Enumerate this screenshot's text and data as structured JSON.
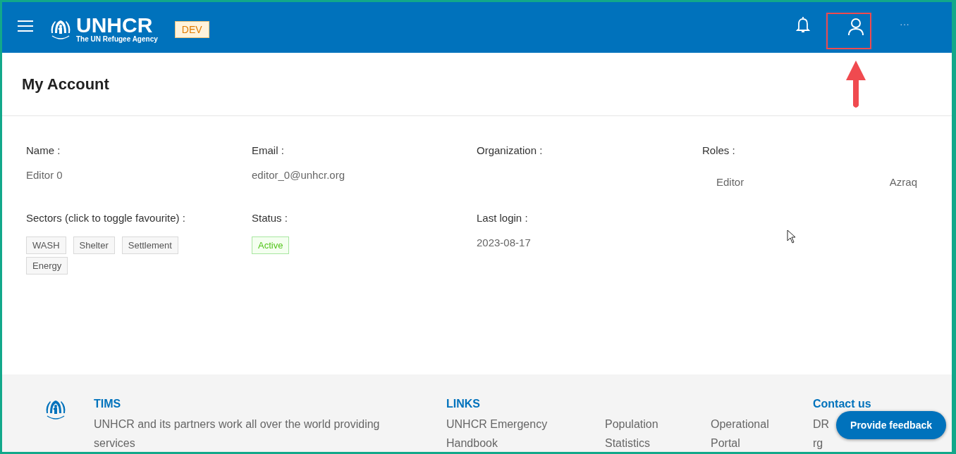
{
  "header": {
    "brand": "UNHCR",
    "tagline": "The UN Refugee Agency",
    "env_badge": "DEV",
    "more": "···"
  },
  "account_button": {
    "highlighted": true
  },
  "page_title": "My Account",
  "fields": [
    {
      "kind": "text",
      "label": "Name :",
      "value": "Editor 0"
    },
    {
      "kind": "text",
      "label": "Email :",
      "value": "editor_0@unhcr.org"
    },
    {
      "kind": "text",
      "label": "Organization :"
    },
    {
      "kind": "roles",
      "label": "Roles :",
      "roles": [
        {
          "role": "Editor",
          "location": "Azraq"
        }
      ]
    },
    {
      "kind": "tags",
      "label": "Sectors (click to toggle favourite) :",
      "tags": [
        "WASH",
        "Shelter",
        "Settlement",
        "Energy"
      ]
    },
    {
      "kind": "status",
      "label": "Status :",
      "value": "Active"
    },
    {
      "kind": "text",
      "label": "Last login :",
      "value": "2023-08-17"
    }
  ],
  "footer": {
    "about": {
      "title": "TIMS",
      "text": "UNHCR and its partners work all over the world providing services"
    },
    "links": {
      "title": "LINKS",
      "items": [
        "UNHCR Emergency Handbook",
        "Population Statistics",
        "Operational Portal"
      ]
    },
    "contact": {
      "title": "Contact us",
      "lines": [
        "DR",
        "rg"
      ]
    }
  },
  "feedback_button": "Provide feedback"
}
